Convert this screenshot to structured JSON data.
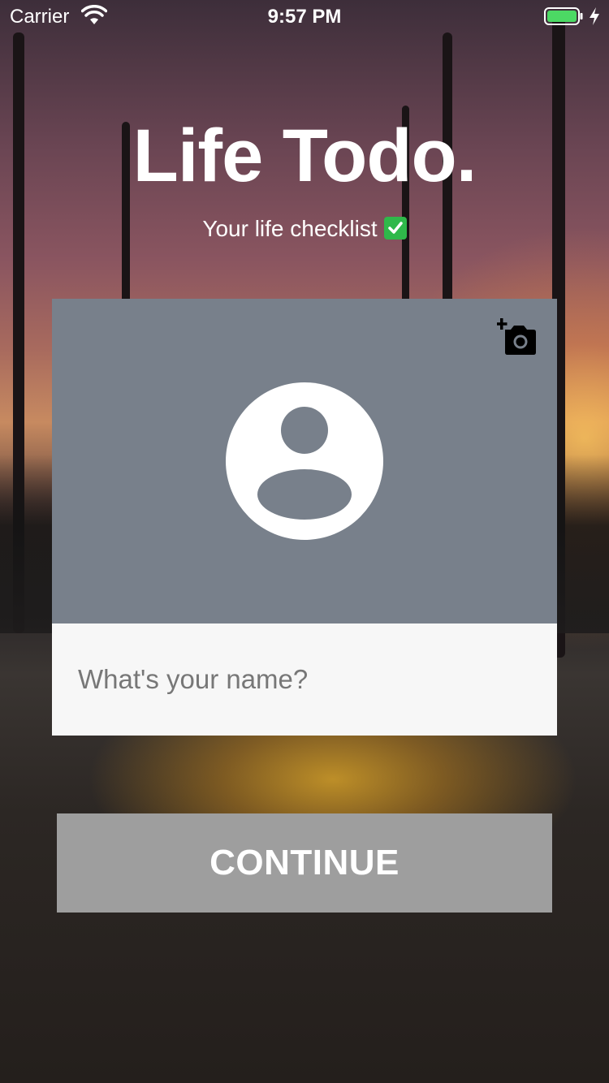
{
  "status_bar": {
    "carrier": "Carrier",
    "time": "9:57 PM",
    "wifi_icon": "wifi-icon",
    "battery_icon": "battery-charging-icon",
    "battery_color": "#4cd964"
  },
  "header": {
    "title": "Life Todo.",
    "subtitle": "Your life checklist",
    "subtitle_icon": "check-mark-button-icon"
  },
  "profile_card": {
    "add_photo_icon": "add-a-photo-icon",
    "avatar_icon": "account-circle-icon",
    "photo_area_color": "#78808b",
    "name_input": {
      "value": "",
      "placeholder": "What's your name?"
    }
  },
  "continue_button": {
    "label": "CONTINUE",
    "color": "#9e9e9e"
  }
}
